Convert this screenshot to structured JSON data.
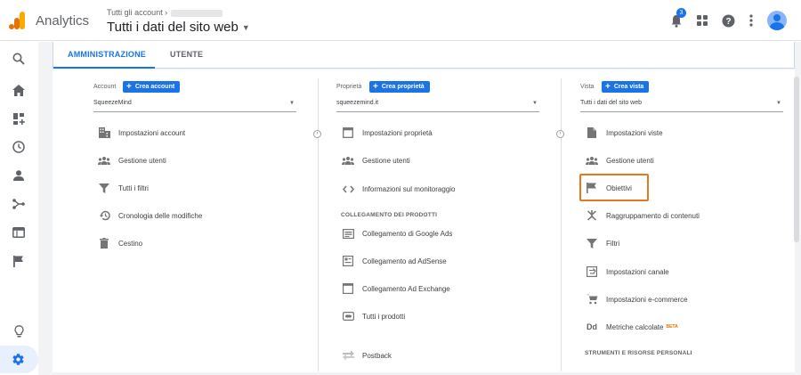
{
  "header": {
    "app_name": "Analytics",
    "breadcrumb": "Tutti gli account",
    "view_title": "Tutti i dati del sito web",
    "notifications_count": "3"
  },
  "tabs": {
    "admin": "AMMINISTRAZIONE",
    "user": "UTENTE"
  },
  "account": {
    "label": "Account",
    "create_button": "Crea account",
    "selected": "SqueezeMind",
    "items": [
      {
        "label": "Impostazioni account",
        "icon": "building-icon"
      },
      {
        "label": "Gestione utenti",
        "icon": "people-icon"
      },
      {
        "label": "Tutti i filtri",
        "icon": "filter-icon"
      },
      {
        "label": "Cronologia delle modifiche",
        "icon": "history-icon"
      },
      {
        "label": "Cestino",
        "icon": "trash-icon"
      }
    ]
  },
  "property": {
    "label": "Proprietà",
    "create_button": "Crea proprietà",
    "selected": "squeezemind.it",
    "items": [
      {
        "label": "Impostazioni proprietà",
        "icon": "property-settings-icon"
      },
      {
        "label": "Gestione utenti",
        "icon": "people-icon"
      },
      {
        "label": "Informazioni sul monitoraggio",
        "icon": "code-icon"
      }
    ],
    "section_label": "COLLEGAMENTO DEI PRODOTTI",
    "links": [
      {
        "label": "Collegamento di Google Ads",
        "icon": "ads-icon"
      },
      {
        "label": "Collegamento ad AdSense",
        "icon": "adsense-icon"
      },
      {
        "label": "Collegamento Ad Exchange",
        "icon": "adexchange-icon"
      },
      {
        "label": "Tutti i prodotti",
        "icon": "link-icon"
      }
    ],
    "postback": "Postback"
  },
  "view": {
    "label": "Vista",
    "create_button": "Crea vista",
    "selected": "Tutti i dati del sito web",
    "items": [
      {
        "label": "Impostazioni viste",
        "icon": "document-icon"
      },
      {
        "label": "Gestione utenti",
        "icon": "people-icon"
      },
      {
        "label": "Obiettivi",
        "icon": "flag-icon"
      },
      {
        "label": "Raggruppamento di contenuti",
        "icon": "grouping-icon"
      },
      {
        "label": "Filtri",
        "icon": "filter-icon"
      },
      {
        "label": "Impostazioni canale",
        "icon": "channel-icon"
      },
      {
        "label": "Impostazioni e-commerce",
        "icon": "cart-icon"
      },
      {
        "label": "Metriche calcolate",
        "icon": "dd-icon",
        "badge": "BETA"
      }
    ],
    "section_label": "STRUMENTI E RISORSE PERSONALI"
  },
  "colors": {
    "accent": "#1a73e8",
    "highlight": "#e87722",
    "active_nav_bg": "#e8f0fe"
  }
}
